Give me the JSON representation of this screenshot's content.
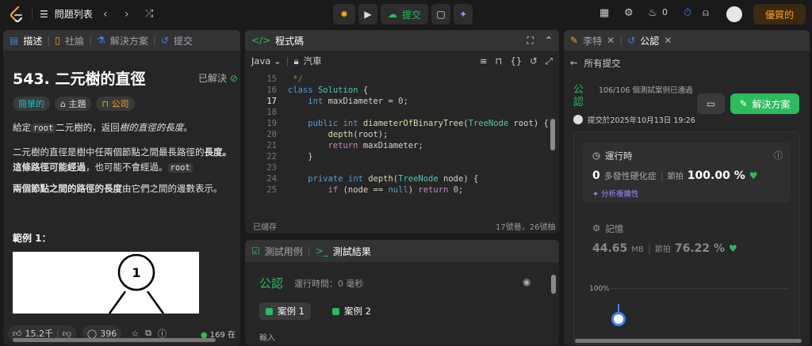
{
  "topbar": {
    "problem_list": "問題列表",
    "submit": "提交",
    "streak_count": "0",
    "premium": "優質的"
  },
  "description_panel": {
    "tabs": [
      "描述",
      "社論",
      "解決方案",
      "提交"
    ],
    "title": "543. 二元樹的直徑",
    "solved": "已解決",
    "tags": [
      "簡單的",
      "主題",
      "公司"
    ],
    "para1_a": "給定",
    "para1_code": "root",
    "para1_b": "二元樹的，返回",
    "para1_c": "樹的直徑的長度",
    "para1_d": "。",
    "para2_a": "二元樹的直徑是樹中任兩個節點之間最長路徑的",
    "para2_b": "長度",
    "para2_c": "。",
    "para2_d": "這條路徑可能經過",
    "para2_e": "，也可能不會經過。",
    "para2_code": "root",
    "para3_a": "兩個節點之間的路徑的長度",
    "para3_b": "由它們之間的邊數表示。",
    "example_title": "範例 1：",
    "tree_node_label": "1",
    "likes": "15.2千",
    "comments": "396",
    "online": "169 在"
  },
  "code_panel": {
    "title": "程式碼",
    "language": "Java",
    "mode": "汽車",
    "saved": "已儲存",
    "position": "17號巷，26號柚",
    "lines": [
      {
        "n": "15",
        "html": "<span class='cm'> */</span>"
      },
      {
        "n": "16",
        "html": "<span class='kw'>class</span> <span class='ty'>Solution</span> <span class='pl'>{</span>"
      },
      {
        "n": "17",
        "html": "<span class='pl'>    </span><span class='kw'>int</span> <span class='pl'>maxDiameter = </span><span class='nm'>0</span><span class='pl'>;</span>"
      },
      {
        "n": "18",
        "html": ""
      },
      {
        "n": "19",
        "html": "<span class='pl'>    </span><span class='kw'>public</span> <span class='kw'>int</span> <span class='fn'>diameterOfBinaryTree</span><span class='pl'>(</span><span class='ty'>TreeNode</span> <span class='pl'>root) {</span>"
      },
      {
        "n": "20",
        "html": "<span class='pl'>        </span><span class='fn'>depth</span><span class='pl'>(root);</span>"
      },
      {
        "n": "21",
        "html": "<span class='pl'>        </span><span class='ws'>return</span> <span class='pl'>maxDiameter;</span>"
      },
      {
        "n": "22",
        "html": "<span class='pl'>    }</span>"
      },
      {
        "n": "23",
        "html": ""
      },
      {
        "n": "24",
        "html": "<span class='pl'>    </span><span class='kw'>private</span> <span class='kw'>int</span> <span class='fn'>depth</span><span class='pl'>(</span><span class='ty'>TreeNode</span> <span class='pl'>node) {</span>"
      },
      {
        "n": "25",
        "html": "<span class='pl'>        </span><span class='ws'>if</span> <span class='pl'>(node == </span><span class='kw'>null</span><span class='pl'>) </span><span class='ws'>return</span> <span class='nm'>0</span><span class='pl'>;</span>"
      }
    ]
  },
  "test_panel": {
    "tab_cases": "測試用例",
    "tab_result": "測試結果",
    "accepted": "公認",
    "runtime": "運行時間：0 毫秒",
    "case1": "案例 1",
    "case2": "案例 2",
    "input_label": "輸入"
  },
  "submission_panel": {
    "tab1": "李特",
    "tab2": "公認",
    "back": "所有提交",
    "status_line1": "公",
    "status_line2": "認",
    "passed": "106/106 個測試案例已通過",
    "submitted": "提交於2025年10月13日 19:26",
    "solution_btn": "解決方案",
    "runtime_title": "運行時",
    "runtime_value": "0",
    "runtime_unit": "多發性硬化症",
    "beats": "節拍",
    "runtime_pct": "100.00 %",
    "analyze": "分析複雜性",
    "memory_title": "記憶",
    "memory_value": "44.65",
    "memory_unit": "MB",
    "memory_pct": "76.22 %",
    "chart_label": "100%"
  }
}
